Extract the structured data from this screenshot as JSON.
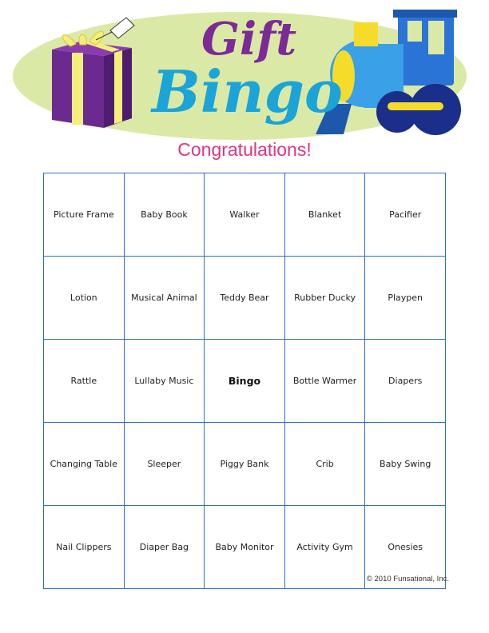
{
  "header": {
    "title_line1": "Gift",
    "title_line2": "Bingo",
    "subtitle": "Congratulations!"
  },
  "icons": [
    "gift-box-icon",
    "toy-train-icon"
  ],
  "colors": {
    "ellipse": "#dbe9a6",
    "gift_title": "#7b2a96",
    "bingo_title": "#1aa4d8",
    "subtitle": "#e0357f",
    "grid_border": "#2b6fd1"
  },
  "board": {
    "rows": [
      [
        "Picture Frame",
        "Baby Book",
        "Walker",
        "Blanket",
        "Pacifier"
      ],
      [
        "Lotion",
        "Musical Animal",
        "Teddy Bear",
        "Rubber Ducky",
        "Playpen"
      ],
      [
        "Rattle",
        "Lullaby Music",
        "Bingo",
        "Bottle Warmer",
        "Diapers"
      ],
      [
        "Changing Table",
        "Sleeper",
        "Piggy Bank",
        "Crib",
        "Baby Swing"
      ],
      [
        "Nail Clippers",
        "Diaper Bag",
        "Baby Monitor",
        "Activity Gym",
        "Onesies"
      ]
    ]
  },
  "footer": {
    "copyright": "© 2010 Funsational, Inc."
  }
}
